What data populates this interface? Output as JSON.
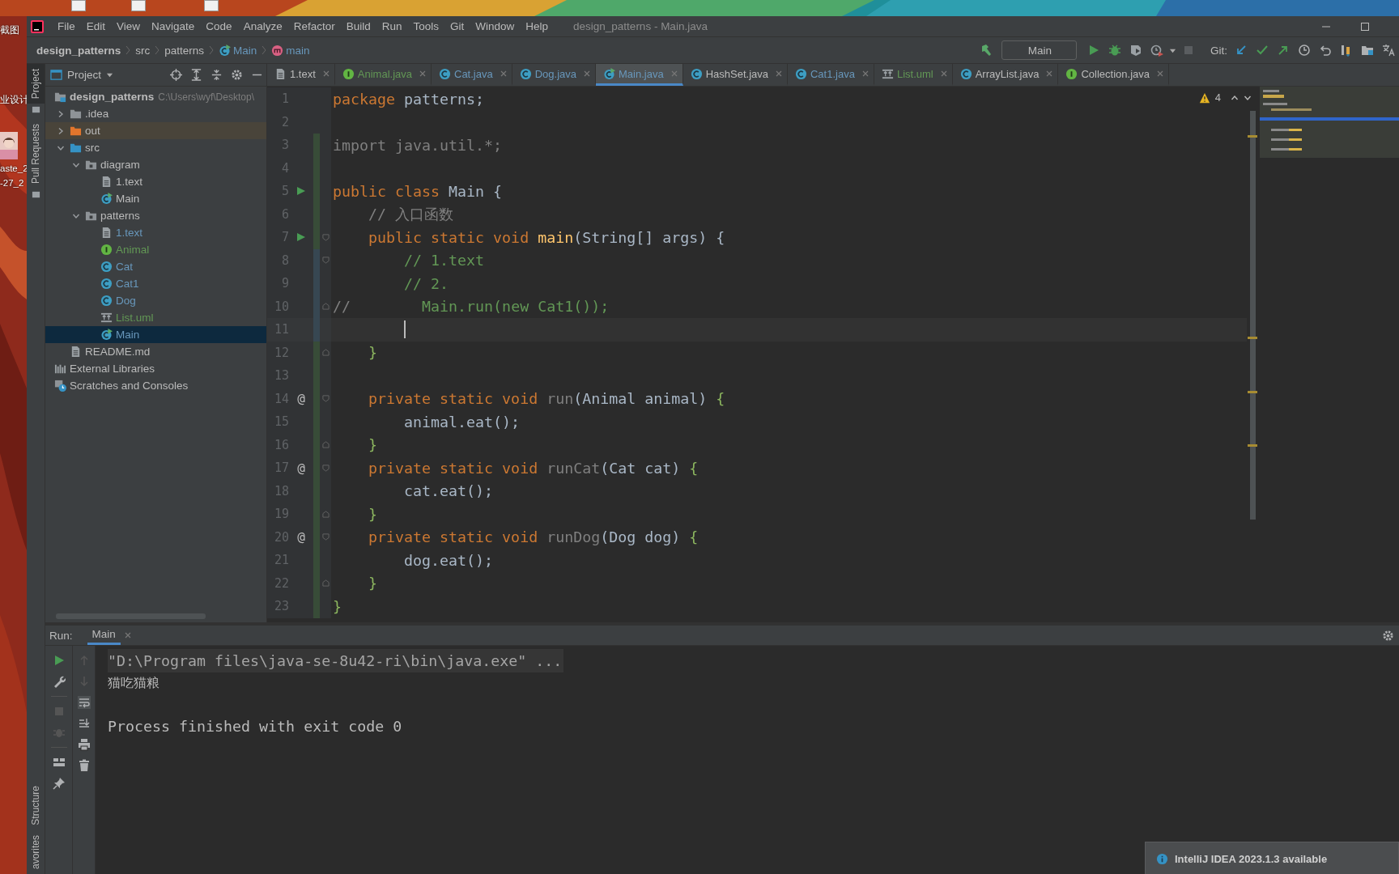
{
  "desktop": {
    "labels": [
      "截图",
      "业设计",
      "aste_2",
      "-27_2"
    ]
  },
  "menu": [
    "File",
    "Edit",
    "View",
    "Navigate",
    "Code",
    "Analyze",
    "Refactor",
    "Build",
    "Run",
    "Tools",
    "Git",
    "Window",
    "Help"
  ],
  "window_title": "design_patterns - Main.java",
  "breadcrumbs": [
    {
      "label": "design_patterns",
      "kind": "project"
    },
    {
      "label": "src",
      "kind": "plain"
    },
    {
      "label": "patterns",
      "kind": "plain"
    },
    {
      "label": "Main",
      "kind": "class"
    },
    {
      "label": "main",
      "kind": "method"
    }
  ],
  "toolbar": {
    "run_config": "Main",
    "git_label": "Git:"
  },
  "tool_strip": {
    "top": [
      {
        "label": "Project",
        "selected": true
      },
      {
        "label": "Pull Requests",
        "selected": false
      }
    ],
    "bottom": [
      {
        "label": "Structure",
        "selected": false
      },
      {
        "label": "avorites",
        "selected": false
      }
    ]
  },
  "project": {
    "title": "Project",
    "tree": [
      {
        "label": "design_patterns",
        "path": "C:\\Users\\wyf\\Desktop\\",
        "kind": "project",
        "color": "#bbbbbb",
        "selected": false,
        "children": [
          {
            "label": ".idea",
            "kind": "folder",
            "color": "#bbbbbb",
            "selected": false,
            "expanded": false
          },
          {
            "label": "out",
            "kind": "excluded",
            "color": "#bbbbbb",
            "selected": false,
            "expanded": false
          },
          {
            "label": "src",
            "kind": "source",
            "color": "#bbbbbb",
            "selected": false,
            "expanded": true,
            "children": [
              {
                "label": "diagram",
                "kind": "package",
                "color": "#bbbbbb",
                "selected": false,
                "expanded": true,
                "children": [
                  {
                    "label": "1.text",
                    "kind": "text",
                    "color": "#bbbbbb",
                    "selected": false
                  },
                  {
                    "label": "Main",
                    "kind": "runclass",
                    "color": "#bbbbbb",
                    "selected": false
                  }
                ]
              },
              {
                "label": "patterns",
                "kind": "package",
                "color": "#bbbbbb",
                "selected": false,
                "expanded": true,
                "children": [
                  {
                    "label": "1.text",
                    "kind": "text",
                    "color": "#6897bb",
                    "selected": false
                  },
                  {
                    "label": "Animal",
                    "kind": "interface",
                    "color": "#629755",
                    "selected": false
                  },
                  {
                    "label": "Cat",
                    "kind": "class",
                    "color": "#6897bb",
                    "selected": false
                  },
                  {
                    "label": "Cat1",
                    "kind": "class",
                    "color": "#6897bb",
                    "selected": false
                  },
                  {
                    "label": "Dog",
                    "kind": "class",
                    "color": "#6897bb",
                    "selected": false
                  },
                  {
                    "label": "List.uml",
                    "kind": "uml",
                    "color": "#629755",
                    "selected": false
                  },
                  {
                    "label": "Main",
                    "kind": "runclass",
                    "color": "#6897bb",
                    "selected": true
                  }
                ]
              }
            ]
          },
          {
            "label": "README.md",
            "kind": "md",
            "color": "#bbbbbb",
            "selected": false
          }
        ]
      },
      {
        "label": "External Libraries",
        "kind": "libraries",
        "color": "#bbbbbb",
        "selected": false
      },
      {
        "label": "Scratches and Consoles",
        "kind": "scratches",
        "color": "#bbbbbb",
        "selected": false
      }
    ]
  },
  "tabs": [
    {
      "label": "1.text",
      "kind": "text",
      "color": "#bbbbbb",
      "selected": false
    },
    {
      "label": "Animal.java",
      "kind": "interface",
      "color": "#629755",
      "selected": false
    },
    {
      "label": "Cat.java",
      "kind": "class",
      "color": "#6897bb",
      "selected": false
    },
    {
      "label": "Dog.java",
      "kind": "class",
      "color": "#6897bb",
      "selected": false
    },
    {
      "label": "Main.java",
      "kind": "runclass",
      "color": "#6897bb",
      "selected": true
    },
    {
      "label": "HashSet.java",
      "kind": "class",
      "color": "#bbbbbb",
      "selected": false
    },
    {
      "label": "Cat1.java",
      "kind": "class",
      "color": "#6897bb",
      "selected": false
    },
    {
      "label": "List.uml",
      "kind": "uml",
      "color": "#629755",
      "selected": false
    },
    {
      "label": "ArrayList.java",
      "kind": "class",
      "color": "#bbbbbb",
      "selected": false
    },
    {
      "label": "Collection.java",
      "kind": "interface",
      "color": "#bbbbbb",
      "selected": false
    }
  ],
  "editor": {
    "warnings": "4",
    "lines": [
      {
        "number": "1",
        "run": false,
        "current": false,
        "fold_start": false,
        "fold_end": false,
        "tokens": [
          {
            "t": "package",
            "kind": "kw"
          },
          {
            "t": " patterns;",
            "kind": "plain"
          }
        ]
      },
      {
        "number": "2",
        "run": false,
        "current": false,
        "fold_start": false,
        "fold_end": false
      },
      {
        "number": "3",
        "run": false,
        "current": false,
        "color": "#384c38",
        "fold_start": false,
        "fold_end": false,
        "tokens": [
          {
            "t": "import java.util.*;",
            "kind": "unused"
          }
        ]
      },
      {
        "number": "4",
        "run": false,
        "current": false,
        "color": "#384c38",
        "fold_start": false,
        "fold_end": false
      },
      {
        "number": "5",
        "run": true,
        "current": false,
        "color": "#384c38",
        "fold_start": false,
        "fold_end": false,
        "tokens": [
          {
            "t": "public class ",
            "kind": "kw"
          },
          {
            "t": "Main {",
            "kind": "plain"
          }
        ]
      },
      {
        "number": "6",
        "run": false,
        "current": false,
        "color": "#384c38",
        "fold_start": false,
        "fold_end": false,
        "tokens": [
          {
            "t": "    // 入口函数",
            "kind": "comment"
          }
        ]
      },
      {
        "number": "7",
        "run": true,
        "current": false,
        "color": "#384c38",
        "fold_start": true,
        "fold_end": false,
        "tokens": [
          {
            "t": "    public static void ",
            "kind": "kw"
          },
          {
            "t": "main",
            "kind": "method"
          },
          {
            "t": "(String[] args) {",
            "kind": "plain"
          }
        ]
      },
      {
        "number": "8",
        "run": false,
        "current": false,
        "color": "#374752",
        "fold_start": true,
        "fold_end": false,
        "tokens": [
          {
            "t": "        // 1.text",
            "kind": "doc"
          }
        ]
      },
      {
        "number": "9",
        "run": false,
        "current": false,
        "color": "#374752",
        "fold_start": false,
        "fold_end": false,
        "tokens": [
          {
            "t": "        // 2.",
            "kind": "doc"
          }
        ]
      },
      {
        "number": "10",
        "run": false,
        "current": false,
        "color": "#374752",
        "fold_start": false,
        "fold_end": true,
        "tokens": [
          {
            "t": "//",
            "kind": "comment"
          },
          {
            "t": "        Main.run(new Cat1());",
            "kind": "doc"
          }
        ]
      },
      {
        "number": "11",
        "run": false,
        "current": true,
        "color": "#374752",
        "fold_start": false,
        "fold_end": false
      },
      {
        "number": "12",
        "run": false,
        "current": false,
        "color": "#384c38",
        "fold_start": false,
        "fold_end": true,
        "tokens": [
          {
            "t": "    }",
            "kind": "brace"
          }
        ]
      },
      {
        "number": "13",
        "run": false,
        "current": false,
        "color": "#384c38",
        "fold_start": false,
        "fold_end": false
      },
      {
        "number": "14",
        "mark": "@",
        "run": false,
        "current": false,
        "color": "#384c38",
        "fold_start": true,
        "fold_end": false,
        "tokens": [
          {
            "t": "    private static void ",
            "kind": "kw"
          },
          {
            "t": "run",
            "kind": "unused"
          },
          {
            "t": "(Animal animal) ",
            "kind": "plain"
          },
          {
            "t": "{",
            "kind": "brace"
          }
        ]
      },
      {
        "number": "15",
        "run": false,
        "current": false,
        "color": "#384c38",
        "fold_start": false,
        "fold_end": false,
        "tokens": [
          {
            "t": "        animal.eat();",
            "kind": "plain"
          }
        ]
      },
      {
        "number": "16",
        "run": false,
        "current": false,
        "color": "#384c38",
        "fold_start": false,
        "fold_end": true,
        "tokens": [
          {
            "t": "    }",
            "kind": "brace"
          }
        ]
      },
      {
        "number": "17",
        "mark": "@",
        "run": false,
        "current": false,
        "color": "#384c38",
        "fold_start": true,
        "fold_end": false,
        "tokens": [
          {
            "t": "    private static void ",
            "kind": "kw"
          },
          {
            "t": "runCat",
            "kind": "unused"
          },
          {
            "t": "(Cat cat) ",
            "kind": "plain"
          },
          {
            "t": "{",
            "kind": "brace"
          }
        ]
      },
      {
        "number": "18",
        "run": false,
        "current": false,
        "color": "#384c38",
        "fold_start": false,
        "fold_end": false,
        "tokens": [
          {
            "t": "        cat.eat();",
            "kind": "plain"
          }
        ]
      },
      {
        "number": "19",
        "run": false,
        "current": false,
        "color": "#384c38",
        "fold_start": false,
        "fold_end": true,
        "tokens": [
          {
            "t": "    }",
            "kind": "brace"
          }
        ]
      },
      {
        "number": "20",
        "mark": "@",
        "run": false,
        "current": false,
        "color": "#384c38",
        "fold_start": true,
        "fold_end": false,
        "tokens": [
          {
            "t": "    private static void ",
            "kind": "kw"
          },
          {
            "t": "runDog",
            "kind": "unused"
          },
          {
            "t": "(Dog dog) ",
            "kind": "plain"
          },
          {
            "t": "{",
            "kind": "brace"
          }
        ]
      },
      {
        "number": "21",
        "run": false,
        "current": false,
        "color": "#384c38",
        "fold_start": false,
        "fold_end": false,
        "tokens": [
          {
            "t": "        dog.eat();",
            "kind": "plain"
          }
        ]
      },
      {
        "number": "22",
        "run": false,
        "current": false,
        "color": "#384c38",
        "fold_start": false,
        "fold_end": true,
        "tokens": [
          {
            "t": "    }",
            "kind": "brace"
          }
        ]
      },
      {
        "number": "23",
        "run": false,
        "current": false,
        "color": "#384c38",
        "fold_start": false,
        "fold_end": false,
        "tokens": [
          {
            "t": "}",
            "kind": "brace"
          }
        ]
      }
    ]
  },
  "run": {
    "label": "Run:",
    "tab": "Main",
    "console": [
      {
        "text": "\"D:\\Program files\\java-se-8u42-ri\\bin\\java.exe\" ...",
        "kind": "command"
      },
      {
        "text": "猫吃猫粮",
        "kind": "output"
      },
      {
        "text": "Process finished with exit code 0",
        "kind": "status"
      }
    ]
  },
  "notification": {
    "title": "IntelliJ IDEA 2023.1.3 available"
  }
}
